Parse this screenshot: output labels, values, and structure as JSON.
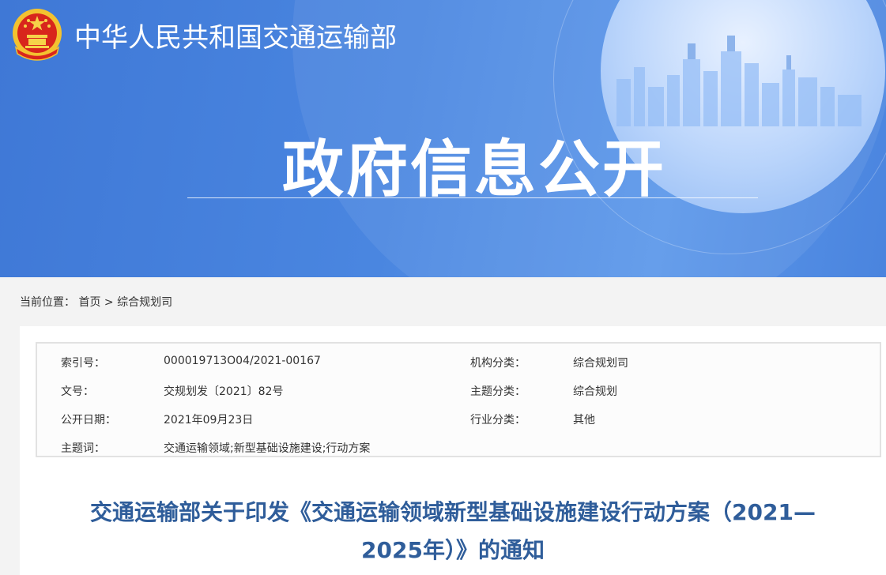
{
  "header": {
    "ministry_name": "中华人民共和国交通运输部",
    "section_title": "政府信息公开",
    "colors": {
      "banner": "#4a86e0",
      "title": "#2f5d9a"
    }
  },
  "breadcrumb": {
    "prefix": "当前位置：",
    "home": "首页",
    "separator": ">",
    "current": "综合规划司"
  },
  "meta": {
    "index_label": "索引号：",
    "index_value": "000019713O04/2021-00167",
    "org_label": "机构分类：",
    "org_value": "综合规划司",
    "docno_label": "文号：",
    "docno_value": "交规划发〔2021〕82号",
    "topic_label": "主题分类：",
    "topic_value": "综合规划",
    "date_label": "公开日期：",
    "date_value": "2021年09月23日",
    "industry_label": "行业分类：",
    "industry_value": "其他",
    "keywords_label": "主题词：",
    "keywords_value": "交通运输领域;新型基础设施建设;行动方案"
  },
  "document": {
    "title_line1": "交通运输部关于印发《交通运输领域新型基础设施建设行动方案（2021—",
    "title_line2": "2025年）》的通知"
  }
}
